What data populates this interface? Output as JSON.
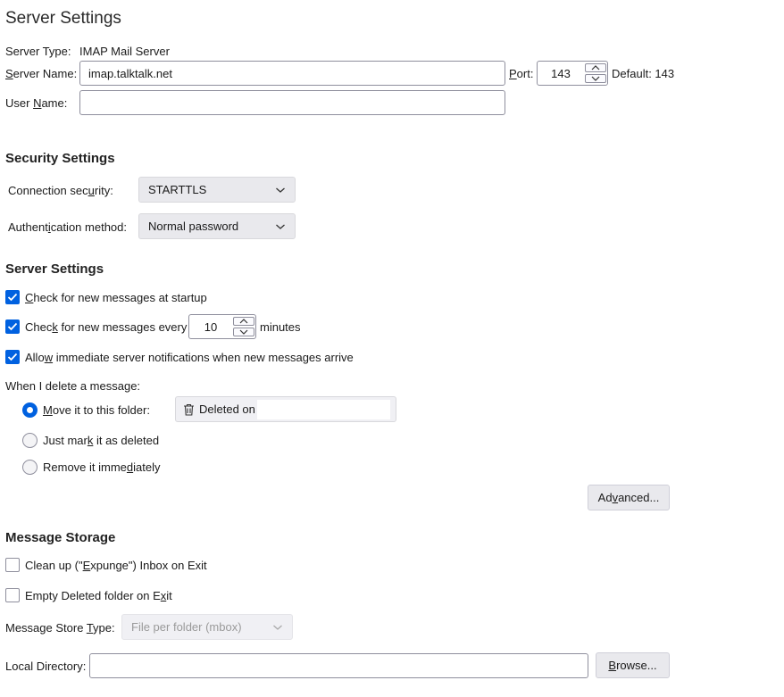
{
  "page_title": "Server Settings",
  "server": {
    "type_label": "Server Type:",
    "type_value": "IMAP Mail Server",
    "name_label_accel": "S",
    "name_label_rest": "erver Name:",
    "name_value": "imap.talktalk.net",
    "port_label_accel": "P",
    "port_label_rest": "ort:",
    "port_value": "143",
    "default_label": "Default: 143",
    "user_label_pre": "User ",
    "user_label_accel": "N",
    "user_label_rest": "ame:",
    "user_value": ""
  },
  "security": {
    "heading": "Security Settings",
    "connection_label_pre": "Connection sec",
    "connection_label_accel": "u",
    "connection_label_rest": "rity:",
    "connection_value": "STARTTLS",
    "auth_label_pre": "Authent",
    "auth_label_accel": "i",
    "auth_label_rest": "cation method:",
    "auth_value": "Normal password"
  },
  "server_settings": {
    "heading": "Server Settings",
    "check_startup_accel": "C",
    "check_startup_rest": "heck for new messages at startup",
    "check_startup_checked": true,
    "check_every_pre": "Chec",
    "check_every_accel": "k",
    "check_every_rest": " for new messages every",
    "check_every_checked": true,
    "check_every_value": "10",
    "minutes_label": "minutes",
    "allow_notify_pre": "Allo",
    "allow_notify_accel": "w",
    "allow_notify_rest": " immediate server notifications when new messages arrive",
    "allow_notify_checked": true,
    "delete_label": "When I delete a message:",
    "move_accel": "M",
    "move_rest": "ove it to this folder:",
    "move_selected": true,
    "folder_value": "Deleted on",
    "mark_pre": "Just mar",
    "mark_accel": "k",
    "mark_rest": " it as deleted",
    "remove_pre": "Remove it imme",
    "remove_accel": "d",
    "remove_rest": "iately",
    "advanced_pre": "Ad",
    "advanced_accel": "v",
    "advanced_rest": "anced..."
  },
  "storage": {
    "heading": "Message Storage",
    "cleanup_pre": "Clean up (\"",
    "cleanup_accel": "E",
    "cleanup_rest": "xpunge\") Inbox on Exit",
    "cleanup_checked": false,
    "empty_pre": "Empty Deleted folder on E",
    "empty_accel": "x",
    "empty_rest": "it",
    "empty_checked": false,
    "store_type_pre": "Message Store ",
    "store_type_accel": "T",
    "store_type_rest": "ype:",
    "store_type_value": "File per folder (mbox)",
    "local_dir_label": "Local Directory:",
    "local_dir_value": "",
    "browse_accel": "B",
    "browse_rest": "rowse..."
  },
  "colors": {
    "accent": "#0061e0",
    "button_bg": "#e9e9ed",
    "border": "#8f8f9d"
  }
}
